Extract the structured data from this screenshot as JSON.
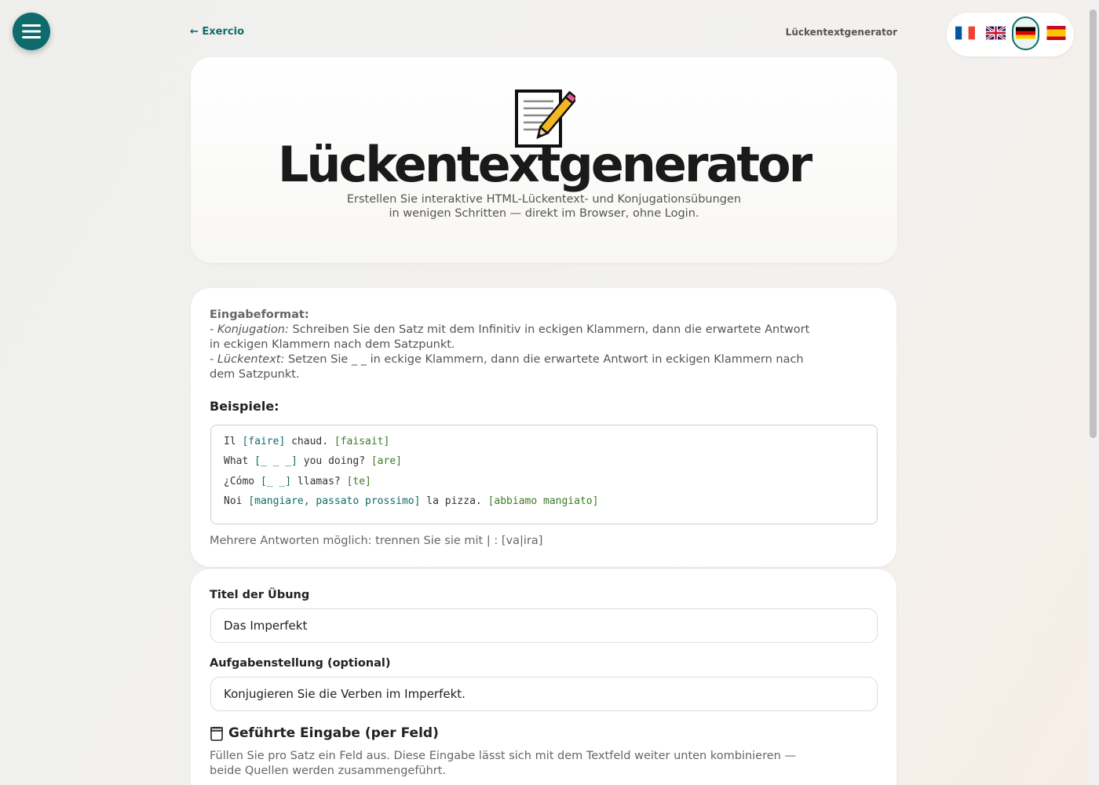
{
  "nav": {
    "back_label": "← Exercio",
    "breadcrumb": "Lückentextgenerator"
  },
  "languages": [
    {
      "code": "fr",
      "icon": "flag-fr-icon"
    },
    {
      "code": "en",
      "icon": "flag-uk-icon"
    },
    {
      "code": "de",
      "icon": "flag-de-icon",
      "selected": true
    },
    {
      "code": "es",
      "icon": "flag-es-icon"
    }
  ],
  "hero": {
    "icon": "memo-pencil-icon",
    "title": "Lückentextgenerator",
    "subtitle": "Erstellen Sie interaktive HTML-Lückentext- und Konjugationsübungen in wenigen Schritten — direkt im Browser, ohne Login."
  },
  "format": {
    "heading": "Eingabeformat:",
    "conj_label": "- Konjugation:",
    "conj_text": " Schreiben Sie den Satz mit dem Infinitiv in eckigen Klammern, dann die erwartete Antwort in eckigen Klammern nach dem Satzpunkt.",
    "gap_label": "- Lückentext:",
    "gap_text": " Setzen Sie _ _ in eckige Klammern, dann die erwartete Antwort in eckigen Klammern nach dem Satzpunkt.",
    "examples_heading": "Beispiele:",
    "examples": [
      {
        "pre": "Il ",
        "blank": "[faire]",
        "mid": " chaud. ",
        "answer": "[faisait]"
      },
      {
        "pre": "What ",
        "blank": "[_ _ _]",
        "mid": " you doing? ",
        "answer": "[are]"
      },
      {
        "pre": "¿Cómo ",
        "blank": "[_ _]",
        "mid": " llamas? ",
        "answer": "[te]"
      },
      {
        "pre": "Noi ",
        "blank": "[mangiare, passato prossimo]",
        "mid": " la pizza. ",
        "answer": "[abbiamo mangiato]"
      }
    ],
    "multi_note": "Mehrere Antworten möglich: trennen Sie sie mit | : [va|ira]"
  },
  "form": {
    "title_label": "Titel der Übung",
    "title_value": "Das Imperfekt",
    "instruction_label": "Aufgabenstellung (optional)",
    "instruction_value": "Konjugieren Sie die Verben im Imperfekt.",
    "guided_icon": "notepad-icon",
    "guided_heading": "Geführte Eingabe (per Feld)",
    "guided_desc": "Füllen Sie pro Satz ein Feld aus. Diese Eingabe lässt sich mit dem Textfeld weiter unten kombinieren — beide Quellen werden zusammengeführt."
  },
  "colors": {
    "accent": "#0f6b6b",
    "answer_green": "#3d7a25"
  }
}
